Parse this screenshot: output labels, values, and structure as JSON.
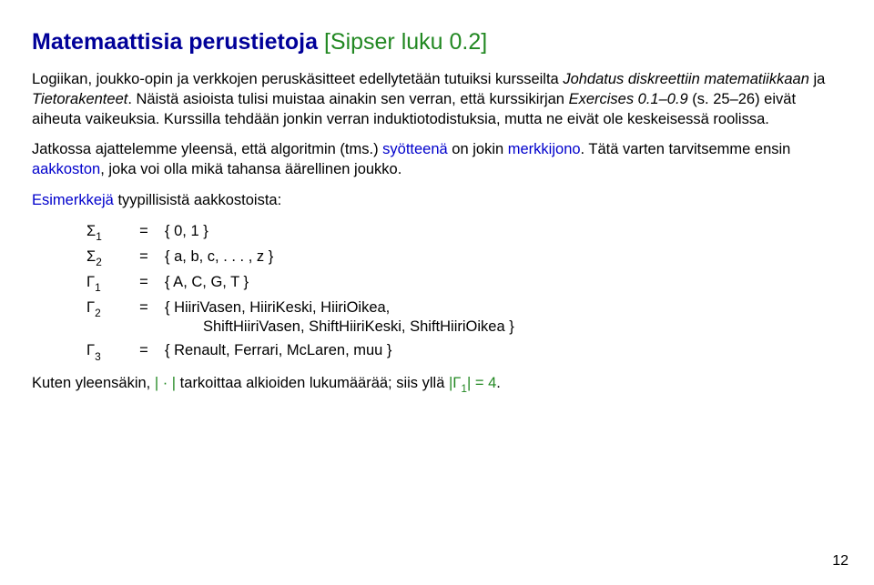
{
  "title": {
    "main": "Matemaattisia perustietoja",
    "ref": "[Sipser luku 0.2]"
  },
  "p1": {
    "t1": "Logiikan, joukko-opin ja verkkojen peruskäsitteet edellytetään tutuiksi kursseilta ",
    "i1": "Johdatus diskreettiin matematiikkaan",
    "t2": " ja ",
    "i2": "Tietorakenteet",
    "t3": ". Näistä asioista tulisi muistaa ainakin sen verran, että kurssikirjan ",
    "i3": "Exercises 0.1–0.9",
    "t4": " (s. 25–26) eivät aiheuta vaikeuksia. Kurssilla tehdään jonkin verran induktiotodistuksia, mutta ne eivät ole keskeisessä roolissa."
  },
  "p2": {
    "t1": "Jatkossa ajattelemme yleensä, että algoritmin (tms.) ",
    "b1": "syötteenä",
    "t2": " on jokin ",
    "b2": "merkkijono",
    "t3": ". Tätä varten tarvitsemme ensin ",
    "b3": "aakkoston",
    "t4": ", joka voi olla mikä tahansa äärellinen joukko."
  },
  "exhead": {
    "b": "Esimerkkejä",
    "t": " tyypillisistä aakkostoista:"
  },
  "rows": {
    "r1": {
      "sym": "Σ",
      "sub": "1",
      "set": "{ 0, 1 }"
    },
    "r2": {
      "sym": "Σ",
      "sub": "2",
      "set": "{ a, b, c, . . . , z }"
    },
    "r3": {
      "sym": "Γ",
      "sub": "1",
      "set": "{ A, C, G, T }"
    },
    "r4": {
      "sym": "Γ",
      "sub": "2",
      "set1": "{ HiiriVasen, HiiriKeski, HiiriOikea,",
      "set2": "ShiftHiiriVasen, ShiftHiiriKeski, ShiftHiiriOikea }"
    },
    "r5": {
      "sym": "Γ",
      "sub": "3",
      "set": "{ Renault, Ferrari, McLaren, muu }"
    }
  },
  "eq": "=",
  "footer": {
    "t1": "Kuten yleensäkin, ",
    "g1": "| · |",
    "t2": " tarkoittaa alkioiden lukumäärää; siis yllä ",
    "g2": "|Γ",
    "g2sub": "1",
    "g3": "| = 4",
    "t3": "."
  },
  "pagenum": "12"
}
